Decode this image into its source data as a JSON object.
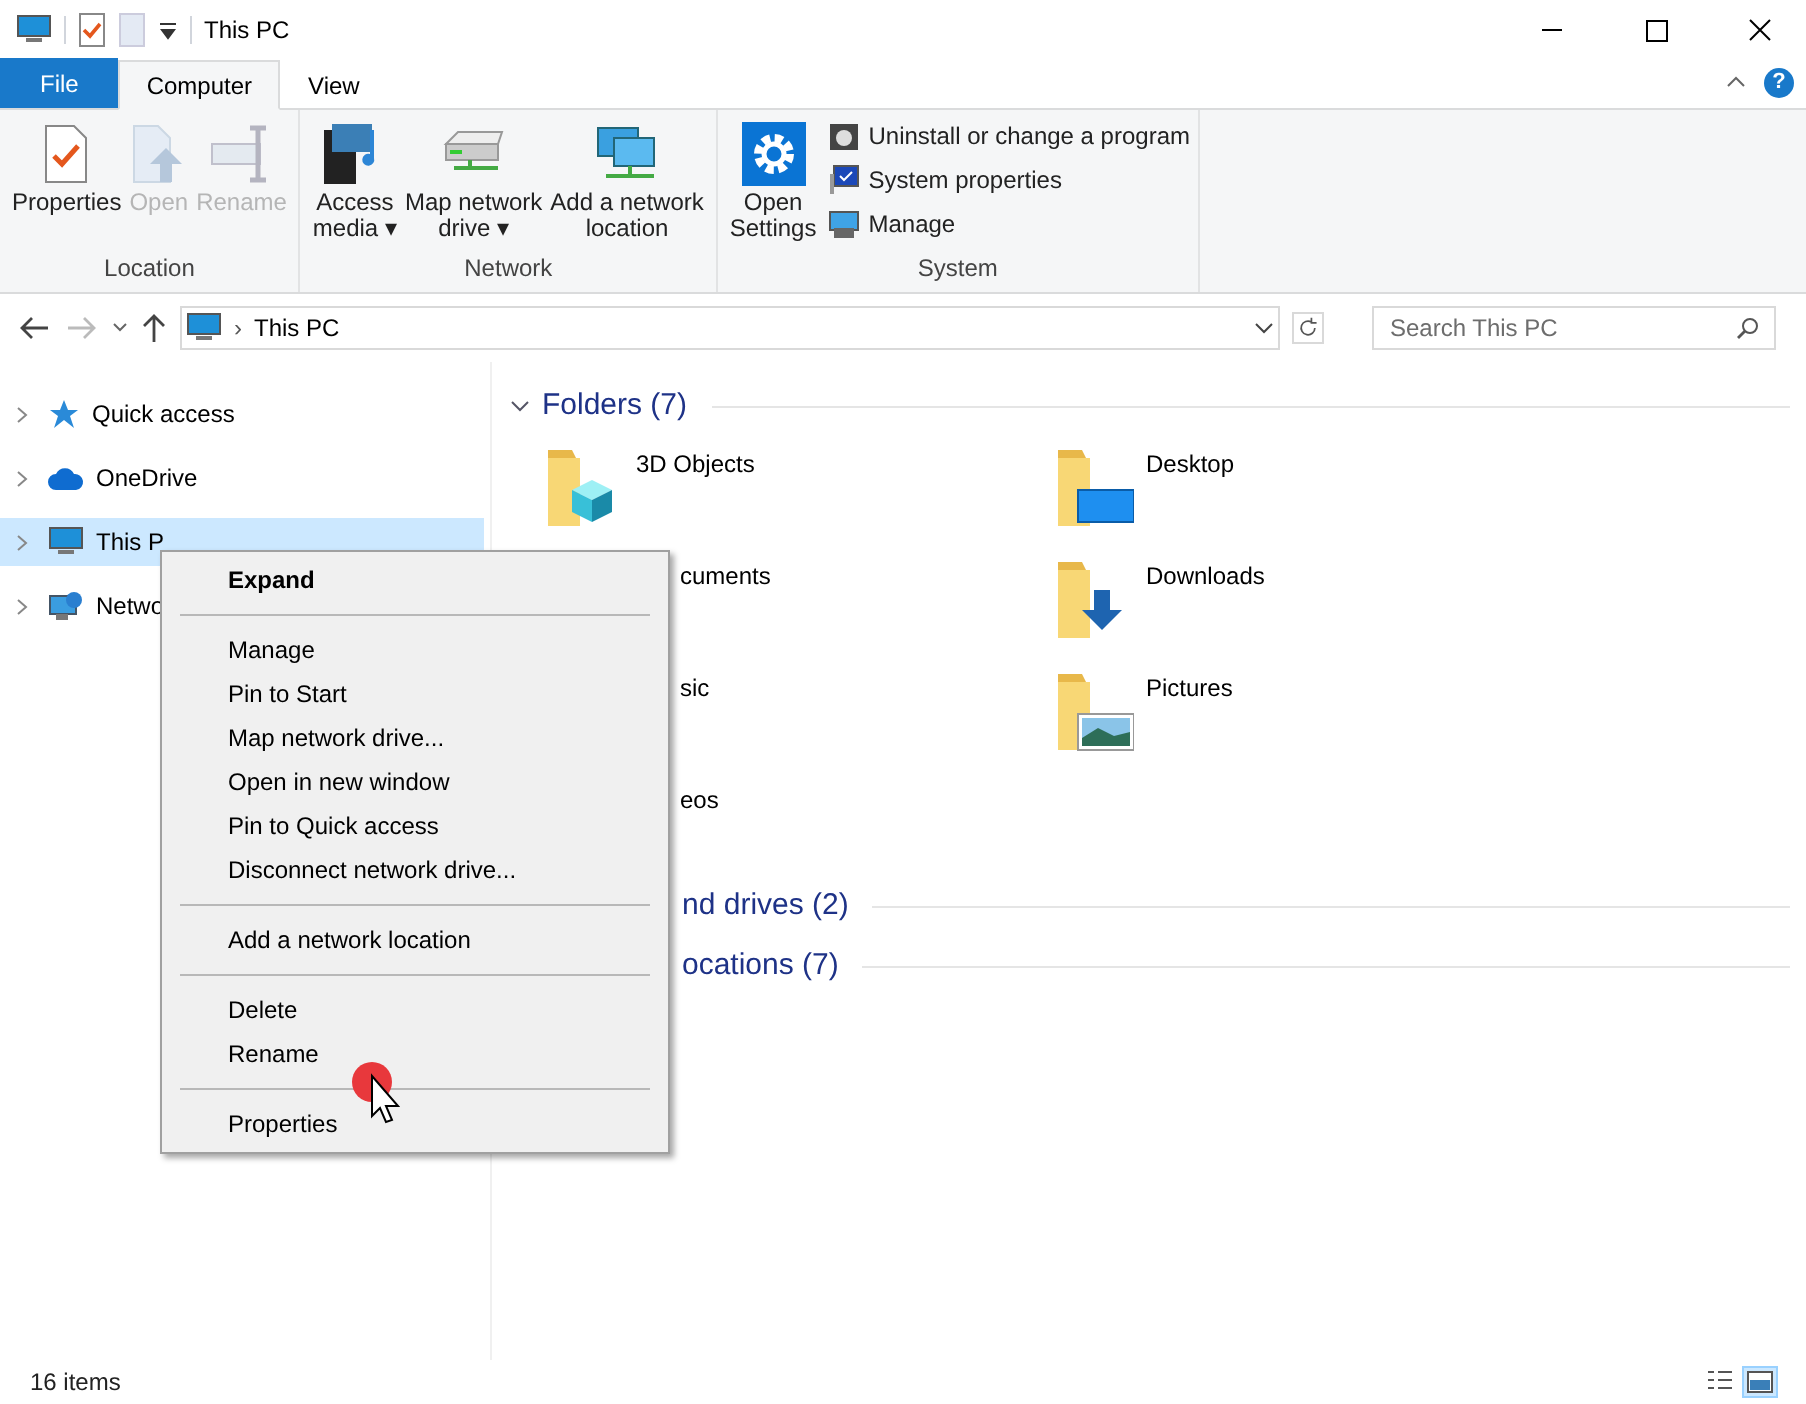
{
  "title_bar": {
    "title": "This PC"
  },
  "ribbon_tabs": [
    {
      "label": "File",
      "kind": "file",
      "selected": false
    },
    {
      "label": "Computer",
      "kind": "tab",
      "selected": true
    },
    {
      "label": "View",
      "kind": "tab",
      "selected": false
    }
  ],
  "help": "?",
  "ribbon_groups": [
    {
      "label": "Location",
      "buttons": [
        {
          "lines": [
            "Properties"
          ],
          "disabled": false
        },
        {
          "lines": [
            "Open"
          ],
          "disabled": true
        },
        {
          "lines": [
            "Rename"
          ],
          "disabled": true
        }
      ]
    },
    {
      "label": "Network",
      "buttons": [
        {
          "lines": [
            "Access",
            "media"
          ],
          "dropdown_arrow": "▾",
          "disabled": false
        },
        {
          "lines": [
            "Map network",
            "drive"
          ],
          "dropdown_arrow": "▾",
          "disabled": false
        },
        {
          "lines": [
            "Add a network",
            "location"
          ],
          "disabled": false
        }
      ]
    },
    {
      "label": "System",
      "buttons": [
        {
          "lines": [
            "Open",
            "Settings"
          ],
          "disabled": false
        }
      ],
      "small_buttons": [
        "Uninstall or change a program",
        "System properties",
        "Manage"
      ]
    }
  ],
  "address_bar": {
    "separator": "›",
    "path": "This PC"
  },
  "search": {
    "placeholder": "Search This PC"
  },
  "sidebar": {
    "items": [
      {
        "label": "Quick access",
        "selected": false
      },
      {
        "label": "OneDrive",
        "selected": false
      },
      {
        "label": "This P",
        "selected": true
      },
      {
        "label": "Netwo",
        "selected": false
      }
    ]
  },
  "content_groups": [
    {
      "title": "Folders (7)",
      "partial": false,
      "items": [
        {
          "label": "3D Objects",
          "partial": false
        },
        {
          "label": "Desktop",
          "partial": false
        },
        {
          "label": "cuments",
          "partial": true
        },
        {
          "label": "Downloads",
          "partial": false
        },
        {
          "label": "sic",
          "partial": true
        },
        {
          "label": "Pictures",
          "partial": false
        },
        {
          "label": "eos",
          "partial": true
        }
      ]
    },
    {
      "title": "nd drives (2)",
      "partial": true
    },
    {
      "title": "ocations (7)",
      "partial": true
    }
  ],
  "context_menu": {
    "sections": [
      [
        {
          "label": "Expand",
          "bold": true
        }
      ],
      [
        {
          "label": "Manage",
          "bold": false
        },
        {
          "label": "Pin to Start",
          "bold": false
        },
        {
          "label": "Map network drive...",
          "bold": false
        },
        {
          "label": "Open in new window",
          "bold": false
        },
        {
          "label": "Pin to Quick access",
          "bold": false
        },
        {
          "label": "Disconnect network drive...",
          "bold": false
        }
      ],
      [
        {
          "label": "Add a network location",
          "bold": false
        }
      ],
      [
        {
          "label": "Delete",
          "bold": false
        },
        {
          "label": "Rename",
          "bold": false
        }
      ],
      [
        {
          "label": "Properties",
          "bold": false
        }
      ]
    ]
  },
  "status_bar": {
    "text": "16 items",
    "views": [
      {
        "selected": false
      },
      {
        "selected": true
      }
    ]
  }
}
